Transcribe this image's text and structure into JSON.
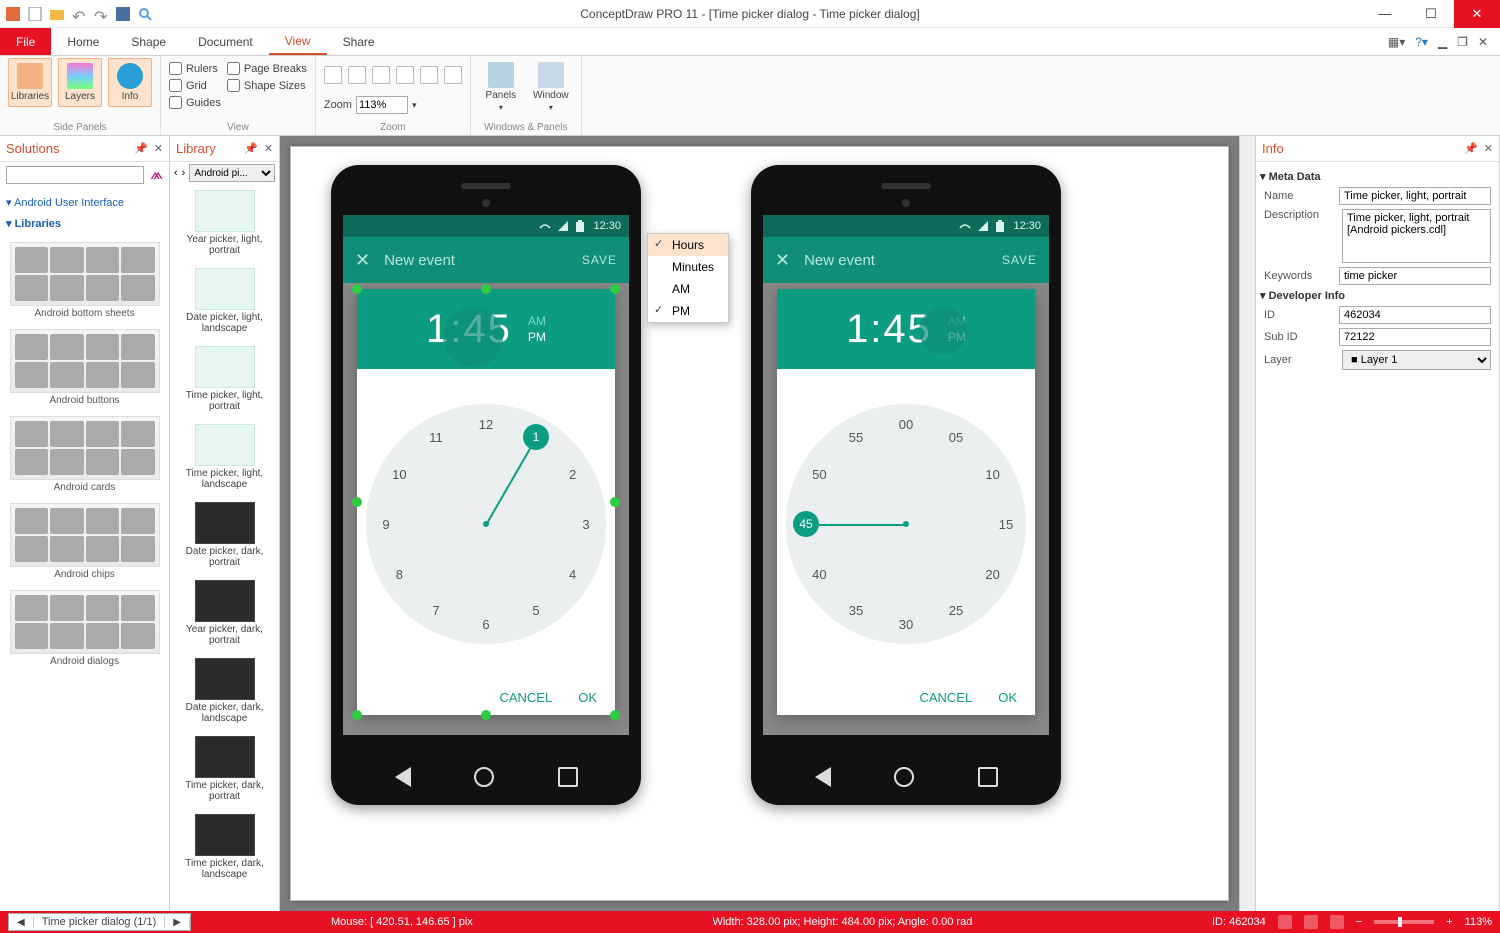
{
  "title": "ConceptDraw PRO 11 - [Time picker dialog - Time picker dialog]",
  "menu": {
    "file": "File",
    "home": "Home",
    "shape": "Shape",
    "document": "Document",
    "view": "View",
    "share": "Share"
  },
  "ribbon": {
    "side_panels": {
      "label": "Side Panels",
      "libraries": "Libraries",
      "layers": "Layers",
      "info": "Info"
    },
    "view": {
      "label": "View",
      "rulers": "Rulers",
      "grid": "Grid",
      "guides": "Guides",
      "page_breaks": "Page Breaks",
      "shape_sizes": "Shape Sizes"
    },
    "zoom": {
      "label": "Zoom",
      "zoom_label": "Zoom",
      "value": "113%"
    },
    "windows": {
      "label": "Windows & Panels",
      "panels": "Panels",
      "window": "Window"
    }
  },
  "solutions": {
    "title": "Solutions",
    "tree": {
      "android_ui": "Android User Interface",
      "libraries": "Libraries"
    },
    "items": [
      "Android bottom sheets",
      "Android buttons",
      "Android cards",
      "Android chips",
      "Android dialogs"
    ]
  },
  "library": {
    "title": "Library",
    "selector": "Android pi...",
    "items": [
      {
        "label": "Year picker, light, portrait",
        "dark": false
      },
      {
        "label": "Date picker, light, landscape",
        "dark": false
      },
      {
        "label": "Time picker, light, portrait",
        "dark": false
      },
      {
        "label": "Time picker, light, landscape",
        "dark": false
      },
      {
        "label": "Date picker, dark, portrait",
        "dark": true
      },
      {
        "label": "Year picker, dark, portrait",
        "dark": true
      },
      {
        "label": "Date picker, dark, landscape",
        "dark": true
      },
      {
        "label": "Time picker, dark, portrait",
        "dark": true
      },
      {
        "label": "Time picker, dark, landscape",
        "dark": true
      }
    ]
  },
  "context_menu": {
    "items": [
      {
        "label": "Hours",
        "checked": true,
        "sel": true
      },
      {
        "label": "Minutes",
        "checked": false,
        "sel": false
      },
      {
        "label": "AM",
        "checked": false,
        "sel": false
      },
      {
        "label": "PM",
        "checked": true,
        "sel": false
      }
    ]
  },
  "phone_common": {
    "status_time": "12:30",
    "app_title": "New event",
    "save": "SAVE",
    "time": "1:45",
    "am": "AM",
    "pm": "PM",
    "cancel": "CANCEL",
    "ok": "OK"
  },
  "phone1": {
    "mode": "hours",
    "numbers": [
      "12",
      "1",
      "2",
      "3",
      "4",
      "5",
      "6",
      "7",
      "8",
      "9",
      "10",
      "11"
    ],
    "selected": "1"
  },
  "phone2": {
    "mode": "minutes",
    "numbers": [
      "00",
      "05",
      "10",
      "15",
      "20",
      "25",
      "30",
      "35",
      "40",
      "45",
      "50",
      "55"
    ],
    "selected": "45"
  },
  "info": {
    "title": "Info",
    "meta_head": "Meta Data",
    "dev_head": "Developer Info",
    "name_label": "Name",
    "name": "Time picker, light, portrait",
    "desc_label": "Description",
    "desc": "Time picker, light, portrait [Android pickers.cdl]",
    "kw_label": "Keywords",
    "kw": "time picker",
    "id_label": "ID",
    "id": "462034",
    "sub_label": "Sub ID",
    "sub": "72122",
    "layer_label": "Layer",
    "layer": "Layer 1"
  },
  "status": {
    "tab": "Time picker dialog (1/1)",
    "mouse_label": "Mouse: [ 420.51, 146.65 ] pix",
    "dims": "Width: 328.00 pix;  Height: 484.00 pix;  Angle: 0.00 rad",
    "idtxt": "ID: 462034",
    "zoom": "113%"
  }
}
